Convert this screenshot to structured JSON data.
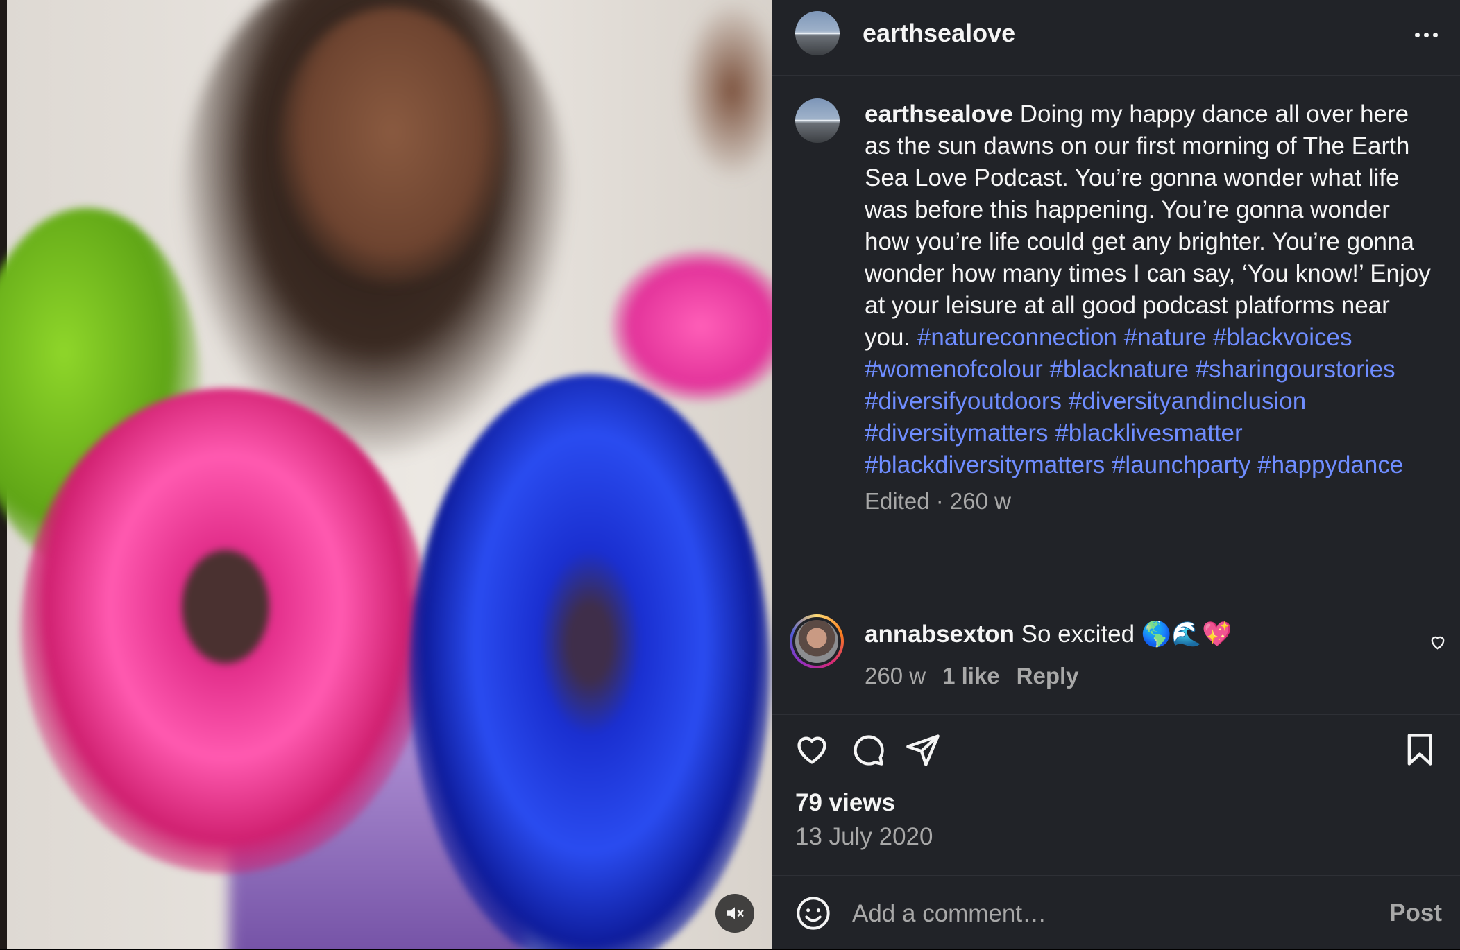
{
  "post": {
    "username": "earthsealove",
    "caption_user": "earthsealove",
    "caption_text": "Doing my happy dance all over here as the sun dawns on our first morning of The Earth Sea Love Podcast. You’re gonna wonder what life was before this happening. You’re gonna wonder how you’re life could get any brighter. You’re gonna wonder how many times I can say, ‘You know!’ Enjoy at your leisure at all good podcast platforms near you.",
    "hashtags": [
      "#natureconnection",
      "#nature",
      "#blackvoices",
      "#womenofcolour",
      "#blacknature",
      "#sharingourstories",
      "#diversifyoutdoors",
      "#diversityandinclusion",
      "#diversitymatters",
      "#blacklivesmatter",
      "#blackdiversitymatters",
      "#launchparty",
      "#happydance"
    ],
    "edited_meta": "Edited · 260 w"
  },
  "comment": {
    "username": "annabsexton",
    "text": "So excited 🌎🌊💖",
    "age": "260 w",
    "likes": "1 like",
    "reply": "Reply"
  },
  "stats": {
    "views": "79 views",
    "date": "13 July 2020"
  },
  "composer": {
    "placeholder": "Add a comment…",
    "post_label": "Post"
  },
  "colors": {
    "panel_bg": "#212328",
    "hashtag": "#6f8dff",
    "secondary_text": "#a8a8a8"
  },
  "icons": [
    "more-icon",
    "heart-icon",
    "comment-icon",
    "share-icon",
    "bookmark-icon",
    "emoji-icon",
    "mute-icon"
  ]
}
